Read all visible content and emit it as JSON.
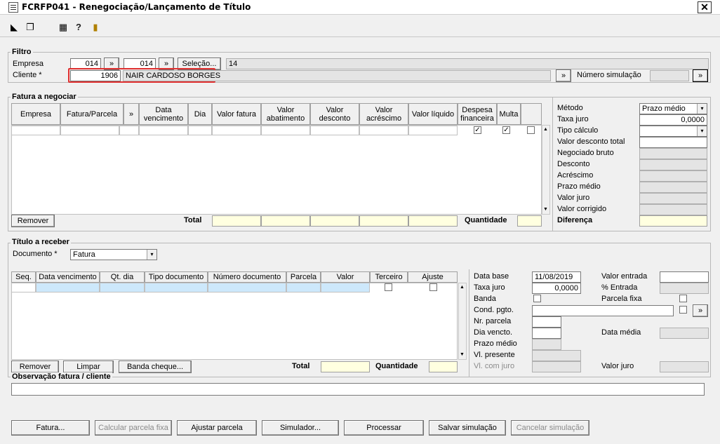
{
  "window": {
    "title": "FCRFP041 - Renegociação/Lançamento de Título",
    "close": "✕"
  },
  "filtro": {
    "label": "Filtro",
    "empresa_label": "Empresa",
    "empresa_de": "014",
    "empresa_ate": "014",
    "selecao_btn": "Seleção...",
    "selecao_value": "14",
    "cliente_label": "Cliente *",
    "cliente_code": "1906",
    "cliente_name": "NAIR CARDOSO BORGES",
    "numero_simulacao_label": "Número simulação"
  },
  "fatura": {
    "label": "Fatura a negociar",
    "columns": [
      "Empresa",
      "Fatura/Parcela",
      "»",
      "Data vencimento",
      "Dia",
      "Valor fatura",
      "Valor abatimento",
      "Valor desconto",
      "Valor acréscimo",
      "Valor líquido",
      "Despesa financeira",
      "Multa"
    ],
    "remover_btn": "Remover",
    "total_label": "Total",
    "quantidade_label": "Quantidade"
  },
  "metodo": {
    "metodo_label": "Método",
    "metodo_value": "Prazo médio",
    "taxa_juro_label": "Taxa juro",
    "taxa_juro_value": "0,0000",
    "tipo_calculo_label": "Tipo cálculo",
    "valor_desconto_total_label": "Valor desconto total",
    "negociado_bruto_label": "Negociado bruto",
    "desconto_label": "Desconto",
    "acrescimo_label": "Acréscimo",
    "prazo_medio_label": "Prazo médio",
    "valor_juro_label": "Valor juro",
    "valor_corrigido_label": "Valor corrigido",
    "diferenca_label": "Diferença"
  },
  "titulo": {
    "label": "Título a receber",
    "documento_label": "Documento *",
    "documento_value": "Fatura",
    "columns": [
      "Seq.",
      "Data vencimento",
      "Qt. dia",
      "Tipo documento",
      "Número documento",
      "Parcela",
      "Valor",
      "Terceiro",
      "Ajuste"
    ],
    "remover_btn": "Remover",
    "limpar_btn": "Limpar",
    "banda_cheque_btn": "Banda cheque...",
    "total_label": "Total",
    "quantidade_label": "Quantidade"
  },
  "detalhes": {
    "data_base_label": "Data base",
    "data_base_value": "11/08/2019",
    "taxa_juro_label": "Taxa juro",
    "taxa_juro_value": "0,0000",
    "banda_label": "Banda",
    "cond_pgto_label": "Cond. pgto.",
    "nr_parcela_label": "Nr. parcela",
    "dia_vencto_label": "Dia vencto.",
    "prazo_medio_label": "Prazo médio",
    "vl_presente_label": "Vl. presente",
    "vl_com_juro_label": "Vl. com juro",
    "valor_entrada_label": "Valor entrada",
    "pct_entrada_label": "% Entrada",
    "parcela_fixa_label": "Parcela fixa",
    "data_media_label": "Data média",
    "valor_juro_label": "Valor juro"
  },
  "observacao": {
    "label": "Observação fatura / cliente"
  },
  "buttons": {
    "fatura": "Fatura...",
    "calcular_parcela_fixa": "Calcular parcela fixa",
    "ajustar_parcela": "Ajustar parcela",
    "simulador": "Simulador...",
    "processar": "Processar",
    "salvar_simulacao": "Salvar simulação",
    "cancelar_simulacao": "Cancelar simulação"
  },
  "icons": {
    "arrow": "»",
    "dropdown": "▾",
    "check": "✓",
    "help": "?"
  }
}
